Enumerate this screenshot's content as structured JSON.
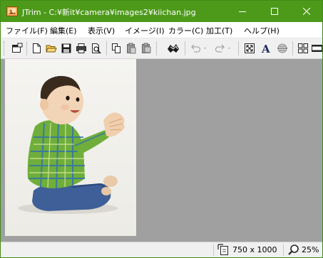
{
  "window": {
    "title": "JTrim - C:¥新it¥camera¥images2¥kiichan.jpg",
    "app_icon": "jtrim-app-icon",
    "accent_color": "#4d9a1a"
  },
  "menu": [
    {
      "label": "ファイル(F)"
    },
    {
      "label": "編集(E)"
    },
    {
      "label": "表示(V)"
    },
    {
      "label": "イメージ(I)"
    },
    {
      "label": "カラー(C)"
    },
    {
      "label": "加工(T)"
    },
    {
      "label": "ヘルプ(H)"
    }
  ],
  "toolbar": {
    "icons": [
      "window-icon",
      "new-file-icon",
      "open-folder-icon",
      "save-icon",
      "print-icon",
      "print-preview-icon",
      "copy-icon",
      "paste-icon",
      "paste-new-icon",
      "crop-icon",
      "undo-icon",
      "redo-icon",
      "fit-window-icon",
      "text-icon",
      "center-icon",
      "grid-view-icon",
      "filmstrip-icon"
    ]
  },
  "image": {
    "description_icon": "photo-baby-icon"
  },
  "status": {
    "dimensions": "750 x 1000",
    "zoom": "25%"
  }
}
